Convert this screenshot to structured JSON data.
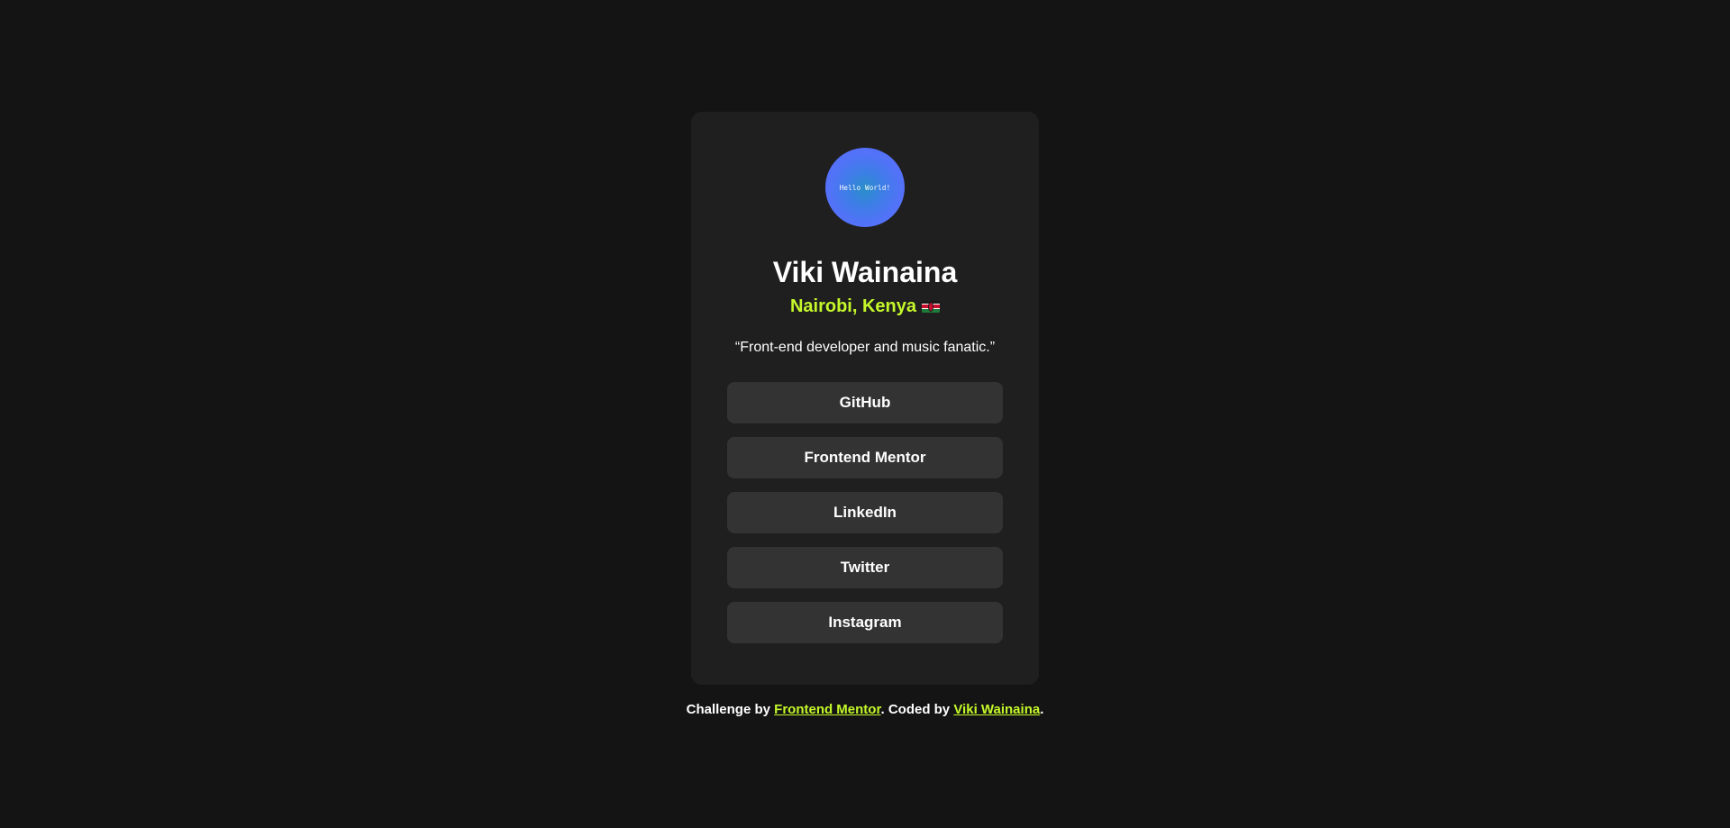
{
  "profile": {
    "avatar_text": "Hello World!",
    "name": "Viki Wainaina",
    "location": "Nairobi, Kenya",
    "location_flag_icon": "kenya-flag-icon",
    "bio": "“Front-end developer and music fanatic.”"
  },
  "links": [
    {
      "label": "GitHub"
    },
    {
      "label": "Frontend Mentor"
    },
    {
      "label": "LinkedIn"
    },
    {
      "label": "Twitter"
    },
    {
      "label": "Instagram"
    }
  ],
  "footer": {
    "prefix": "Challenge by ",
    "challenge_link": "Frontend Mentor",
    "middle": ". Coded by ",
    "author_link": "Viki Wainaina",
    "suffix": "."
  },
  "colors": {
    "background": "#141414",
    "card": "#1f1f1f",
    "button": "#333333",
    "accent": "#c4f82a",
    "text": "#ffffff"
  }
}
